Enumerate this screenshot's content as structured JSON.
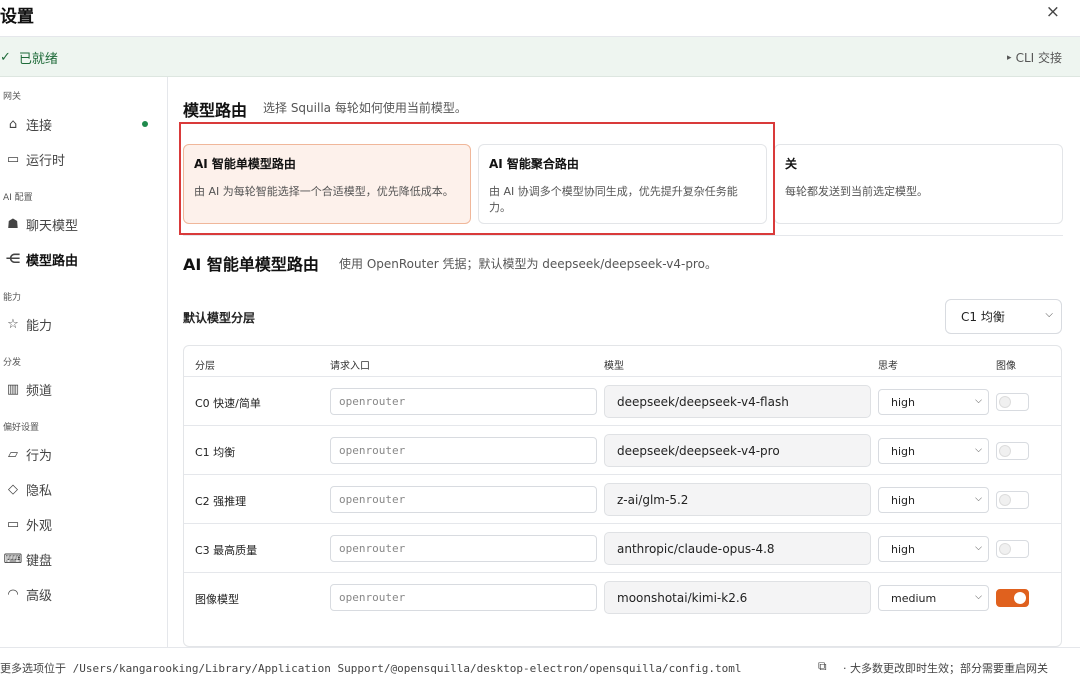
{
  "window": {
    "title": "设置",
    "close_label": "×"
  },
  "status": {
    "check": "✓",
    "ready_text": "已就绪",
    "cli_arrow": "▸",
    "cli_text": "CLI 交接"
  },
  "sidebar": {
    "sections": [
      {
        "title": "网关",
        "items": [
          {
            "icon": "home-icon",
            "glyph": "⌂",
            "label": "连接",
            "online": true
          },
          {
            "icon": "monitor-icon",
            "glyph": "▭",
            "label": "运行时"
          }
        ]
      },
      {
        "title": "AI 配置",
        "items": [
          {
            "icon": "bot-icon",
            "glyph": "☗",
            "label": "聊天模型"
          },
          {
            "icon": "share-icon",
            "glyph": "⋲",
            "label": "模型路由",
            "active": true
          }
        ]
      },
      {
        "title": "能力",
        "items": [
          {
            "icon": "star-icon",
            "glyph": "☆",
            "label": "能力"
          }
        ]
      },
      {
        "title": "分发",
        "items": [
          {
            "icon": "channels-icon",
            "glyph": "▥",
            "label": "频道"
          }
        ]
      },
      {
        "title": "偏好设置",
        "items": [
          {
            "icon": "message-icon",
            "glyph": "▱",
            "label": "行为"
          },
          {
            "icon": "shield-icon",
            "glyph": "◇",
            "label": "隐私"
          },
          {
            "icon": "monitor-icon",
            "glyph": "▭",
            "label": "外观"
          },
          {
            "icon": "keyboard-icon",
            "glyph": "⌨",
            "label": "键盘"
          },
          {
            "icon": "gauge-icon",
            "glyph": "◠",
            "label": "高级"
          }
        ]
      }
    ]
  },
  "routing": {
    "title": "模型路由",
    "subtitle": "选择 Squilla 每轮如何使用当前模型。",
    "options": [
      {
        "title": "AI 智能单模型路由",
        "desc": "由 AI 为每轮智能选择一个合适模型，优先降低成本。",
        "selected": true
      },
      {
        "title": "AI 智能聚合路由",
        "desc": "由 AI 协调多个模型协同生成，优先提升复杂任务能力。",
        "selected": false
      },
      {
        "title": "关",
        "desc": "每轮都发送到当前选定模型。",
        "selected": false
      }
    ]
  },
  "single": {
    "title": "AI 智能单模型路由",
    "subtitle": "使用 OpenRouter 凭据；默认模型为 deepseek/deepseek-v4-pro。",
    "tier_label": "默认模型分层",
    "tier_value": "C1 均衡",
    "chevron": "⌵",
    "columns": {
      "tier": "分层",
      "entry": "请求入口",
      "model": "模型",
      "think": "思考",
      "image": "图像"
    },
    "rows": [
      {
        "tier": "C0 快速/简单",
        "entry_placeholder": "openrouter",
        "model": "deepseek/deepseek-v4-flash",
        "think": "high",
        "image": false
      },
      {
        "tier": "C1 均衡",
        "entry_placeholder": "openrouter",
        "model": "deepseek/deepseek-v4-pro",
        "think": "high",
        "image": false
      },
      {
        "tier": "C2 强推理",
        "entry_placeholder": "openrouter",
        "model": "z-ai/glm-5.2",
        "think": "high",
        "image": false
      },
      {
        "tier": "C3 最高质量",
        "entry_placeholder": "openrouter",
        "model": "anthropic/claude-opus-4.8",
        "think": "high",
        "image": false
      },
      {
        "tier": "图像模型",
        "entry_placeholder": "openrouter",
        "model": "moonshotai/kimi-k2.6",
        "think": "medium",
        "image": true
      }
    ]
  },
  "footer": {
    "path_text": "更多选项位于 /Users/kangarooking/Library/Application Support/@opensquilla/desktop-electron/opensquilla/config.toml",
    "copy_icon": "⧉",
    "note": "· 大多数更改即时生效；部分需要重启网关"
  },
  "colors": {
    "accent": "#e0611e",
    "ready": "#1f6b3a",
    "highlight": "#d93a3a"
  }
}
